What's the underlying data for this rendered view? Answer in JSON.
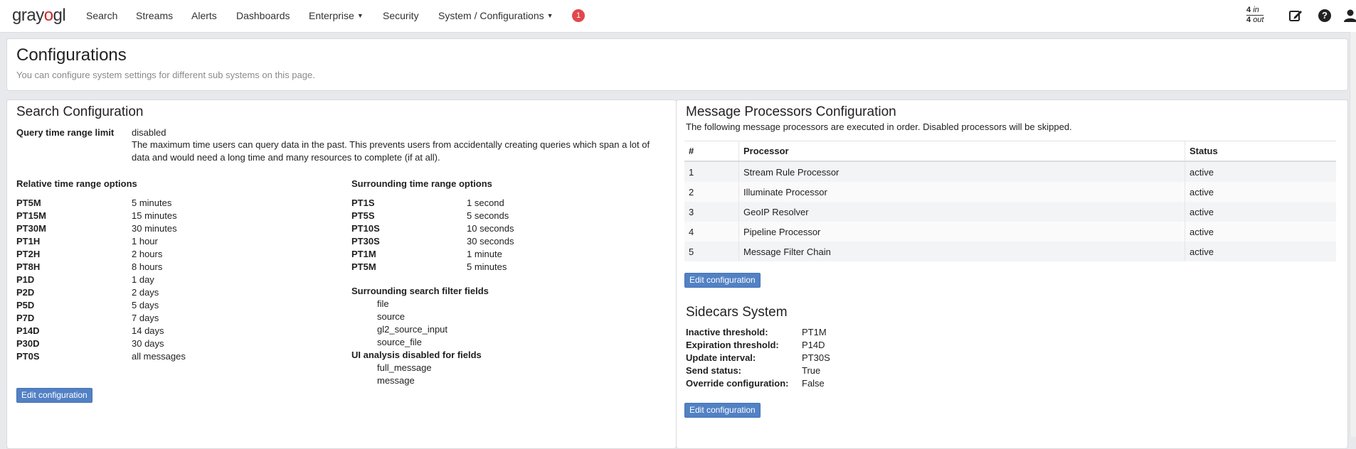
{
  "nav": {
    "logo_gray": "gray",
    "logo_o": "o",
    "logo_g": "g",
    "logo_l": "l",
    "items": [
      "Search",
      "Streams",
      "Alerts",
      "Dashboards",
      "Enterprise",
      "Security",
      "System / Configurations"
    ],
    "notification_count": "1",
    "throughput_in_value": "4",
    "throughput_in_unit": "in",
    "throughput_out_value": "4",
    "throughput_out_unit": "out",
    "help_glyph": "?"
  },
  "header": {
    "title": "Configurations",
    "subtitle": "You can configure system settings for different sub systems on this page."
  },
  "search_config": {
    "title": "Search Configuration",
    "query_limit_label": "Query time range limit",
    "query_limit_value": "disabled",
    "query_limit_desc": "The maximum time users can query data in the past. This prevents users from accidentally creating queries which span a lot of data and would need a long time and many resources to complete (if at all).",
    "relative_title": "Relative time range options",
    "relative": [
      {
        "k": "PT5M",
        "v": "5 minutes"
      },
      {
        "k": "PT15M",
        "v": "15 minutes"
      },
      {
        "k": "PT30M",
        "v": "30 minutes"
      },
      {
        "k": "PT1H",
        "v": "1 hour"
      },
      {
        "k": "PT2H",
        "v": "2 hours"
      },
      {
        "k": "PT8H",
        "v": "8 hours"
      },
      {
        "k": "P1D",
        "v": "1 day"
      },
      {
        "k": "P2D",
        "v": "2 days"
      },
      {
        "k": "P5D",
        "v": "5 days"
      },
      {
        "k": "P7D",
        "v": "7 days"
      },
      {
        "k": "P14D",
        "v": "14 days"
      },
      {
        "k": "P30D",
        "v": "30 days"
      },
      {
        "k": "PT0S",
        "v": "all messages"
      }
    ],
    "surrounding_title": "Surrounding time range options",
    "surrounding": [
      {
        "k": "PT1S",
        "v": "1 second"
      },
      {
        "k": "PT5S",
        "v": "5 seconds"
      },
      {
        "k": "PT10S",
        "v": "10 seconds"
      },
      {
        "k": "PT30S",
        "v": "30 seconds"
      },
      {
        "k": "PT1M",
        "v": "1 minute"
      },
      {
        "k": "PT5M",
        "v": "5 minutes"
      }
    ],
    "filter_title": "Surrounding search filter fields",
    "filter_fields": [
      "file",
      "source",
      "gl2_source_input",
      "source_file"
    ],
    "ui_title": "UI analysis disabled for fields",
    "ui_fields": [
      "full_message",
      "message"
    ],
    "edit_label": "Edit configuration"
  },
  "processors": {
    "title": "Message Processors Configuration",
    "subtitle": "The following message processors are executed in order. Disabled processors will be skipped.",
    "columns": [
      "#",
      "Processor",
      "Status"
    ],
    "rows": [
      {
        "n": "1",
        "name": "Stream Rule Processor",
        "status": "active"
      },
      {
        "n": "2",
        "name": "Illuminate Processor",
        "status": "active"
      },
      {
        "n": "3",
        "name": "GeoIP Resolver",
        "status": "active"
      },
      {
        "n": "4",
        "name": "Pipeline Processor",
        "status": "active"
      },
      {
        "n": "5",
        "name": "Message Filter Chain",
        "status": "active"
      }
    ],
    "edit_label": "Edit configuration"
  },
  "sidecars": {
    "title": "Sidecars System",
    "items": [
      {
        "k": "Inactive threshold:",
        "v": "PT1M"
      },
      {
        "k": "Expiration threshold:",
        "v": "P14D"
      },
      {
        "k": "Update interval:",
        "v": "PT30S"
      },
      {
        "k": "Send status:",
        "v": "True"
      },
      {
        "k": "Override configuration:",
        "v": "False"
      }
    ],
    "edit_label": "Edit configuration"
  }
}
